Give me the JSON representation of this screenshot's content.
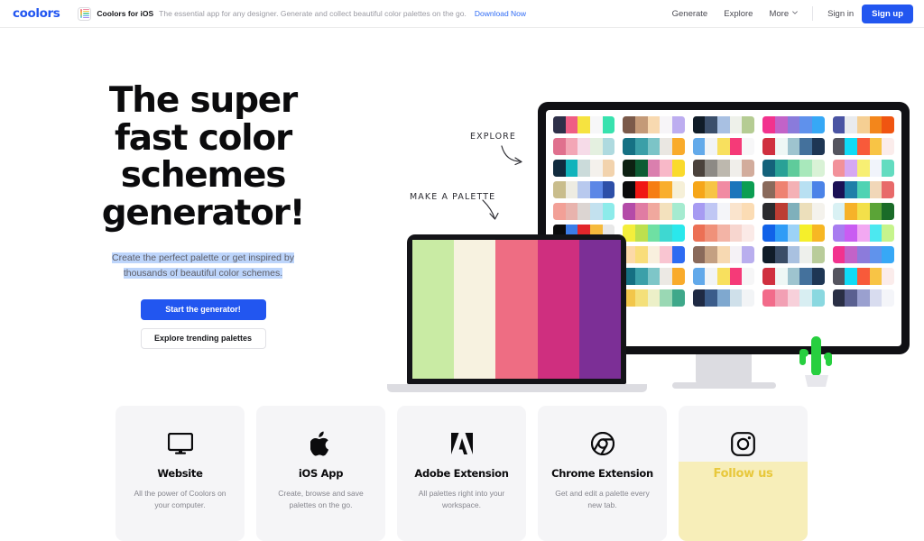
{
  "header": {
    "logo": "coolors",
    "banner": {
      "icon": "ios-app-icon",
      "title": "Coolors for iOS",
      "text": "The essential app for any designer. Generate and collect beautiful color palettes on the go.",
      "link": "Download Now"
    },
    "nav": [
      {
        "label": "Generate"
      },
      {
        "label": "Explore"
      },
      {
        "label": "More",
        "icon": "chevron-down-icon"
      }
    ],
    "signin": "Sign in",
    "signup": "Sign up",
    "accent": "#2256f0"
  },
  "hero": {
    "headline": "The super fast color schemes generator!",
    "subhead": "Create the perfect palette or get inspired by thousands of beautiful color schemes.",
    "primary_button": "Start the generator!",
    "secondary_button": "Explore trending palettes",
    "annotations": [
      {
        "label": "EXPLORE"
      },
      {
        "label": "MAKE A PALETTE"
      }
    ]
  },
  "laptop": {
    "palette": [
      "#c9eba4",
      "#f7f2e0",
      "#ee6d83",
      "#cf2f7f",
      "#7c2f96"
    ]
  },
  "monitor": {
    "palettes": [
      [
        "#2e3049",
        "#ef5e85",
        "#f6e340",
        "#f7f7f8",
        "#38e2ae"
      ],
      [
        "#7b5a4a",
        "#c49a78",
        "#f8d9b0",
        "#f7f5f8",
        "#bdadf0"
      ],
      [
        "#101c28",
        "#3b4f6b",
        "#a8c0e2",
        "#eef1ea",
        "#b5cc93"
      ],
      [
        "#f2338e",
        "#c263c8",
        "#8a7bdb",
        "#5f91ec",
        "#36a8f6"
      ],
      [
        "#4a54a3",
        "#e9ebee",
        "#f5cf93",
        "#f3861b",
        "#f05511"
      ],
      [
        "#e0708e",
        "#f3a6b6",
        "#f6dbe8",
        "#e4f0e0",
        "#aedadf"
      ],
      [
        "#167184",
        "#3b9fa8",
        "#7cc4c7",
        "#eae7e2",
        "#f9ab2b"
      ],
      [
        "#63aaea",
        "#f2f4f6",
        "#f8e05e",
        "#f53a78",
        "#f7f7f8"
      ],
      [
        "#d0303f",
        "#eef7f5",
        "#9ec4cf",
        "#44719c",
        "#1e3654"
      ],
      [
        "#55555f",
        "#10dbf5",
        "#f85a3a",
        "#f8c445",
        "#fbeceb"
      ],
      [
        "#112b3e",
        "#11b3bb",
        "#cbdbda",
        "#f4f1ec",
        "#f2d3ad"
      ],
      [
        "#0d2112",
        "#0d5c34",
        "#da7fae",
        "#f8b8c8",
        "#fada2c"
      ],
      [
        "#4a423c",
        "#8d8a85",
        "#bdb8ae",
        "#f0eeea",
        "#d2ac9c"
      ],
      [
        "#14627a",
        "#29a196",
        "#5fcb9b",
        "#a8e8bb",
        "#d9f2d6"
      ],
      [
        "#f2919a",
        "#d6a8f2",
        "#f7ef73",
        "#f1f4fb",
        "#63dcc0"
      ],
      [
        "#c9bd8c",
        "#eeece2",
        "#b8c9ee",
        "#5c87e6",
        "#2d4fa8"
      ],
      [
        "#0b0b0c",
        "#f01713",
        "#f67d13",
        "#f9ae2d",
        "#f6f0d8"
      ],
      [
        "#f6a619",
        "#f7c445",
        "#f18ba3",
        "#1c75bb",
        "#0c9e52"
      ],
      [
        "#8a6a5b",
        "#ee8271",
        "#f4b1b5",
        "#b8e0f2",
        "#4b83e8"
      ],
      [
        "#1b1155",
        "#1f7fa8",
        "#4fd3b3",
        "#f1d7b8",
        "#e86a6a"
      ],
      [
        "#f2a097",
        "#e8b3ad",
        "#dcd5d2",
        "#c3e1ef",
        "#8cebea"
      ],
      [
        "#b44ba8",
        "#e07ca3",
        "#f0a89e",
        "#f3e1bd",
        "#a5ebd0"
      ],
      [
        "#a79bf2",
        "#c0c7f4",
        "#f4f5f9",
        "#fae4cd",
        "#fbdcb4"
      ],
      [
        "#2b2b2e",
        "#bc3d33",
        "#7fb0bb",
        "#ecdfbb",
        "#f4f2ec"
      ],
      [
        "#d9f1f4",
        "#f6b229",
        "#f3e04a",
        "#5ba437",
        "#1a6b28"
      ],
      [
        "#0b0b0c",
        "#3b7de8",
        "#e2262b",
        "#f6ba3c",
        "#e8e8e8"
      ],
      [
        "#f4ee3c",
        "#bde04e",
        "#6fe0a3",
        "#3ed8d1",
        "#2ae8ec"
      ],
      [
        "#ec7055",
        "#f0917a",
        "#f3b4a6",
        "#f7d6cf",
        "#fbeae7"
      ],
      [
        "#1162e8",
        "#2f9cf6",
        "#9cd2f7",
        "#f5ef2b",
        "#f7b723"
      ],
      [
        "#a87cf0",
        "#c95cf2",
        "#f2a8f2",
        "#4ce8f0",
        "#c6f48c"
      ],
      [
        "#0a36c8",
        "#5a4fdc",
        "#8a8ae0",
        "#ee9aa0",
        "#f34e9e"
      ],
      [
        "#fcd9a8",
        "#f9dd7a",
        "#f9f0de",
        "#f9c5d1",
        "#2e6bf2"
      ],
      [
        "#8a6a5b",
        "#c4a082",
        "#f7d9b2",
        "#f5f2f6",
        "#b9aeee"
      ],
      [
        "#101c28",
        "#3a4d66",
        "#a9c1e0",
        "#eef0ec",
        "#b9cc9a"
      ],
      [
        "#f2338e",
        "#c263c8",
        "#8c7bdb",
        "#6093ec",
        "#37a8f6"
      ],
      [
        "#4a54a3",
        "#e9ebee",
        "#f5cf93",
        "#f3861b",
        "#f05511"
      ],
      [
        "#156f82",
        "#3ba0a9",
        "#7ec6c8",
        "#ece9e4",
        "#f9ab2b"
      ],
      [
        "#62a9ea",
        "#f2f4f6",
        "#f8e05e",
        "#f53a78",
        "#f6f6f7"
      ],
      [
        "#d0303f",
        "#eef7f5",
        "#9ec4cf",
        "#44719c",
        "#1e3654"
      ],
      [
        "#55555f",
        "#10dbf5",
        "#f85a3a",
        "#f8c445",
        "#fbeceb"
      ],
      [
        "#e8e2cf",
        "#f2f0e8",
        "#cfd8ea",
        "#7fa0e2",
        "#3f5fb8"
      ],
      [
        "#f2c64a",
        "#f4e07a",
        "#ecf0c8",
        "#9ad8b4",
        "#3fa88a"
      ],
      [
        "#1f2a44",
        "#3b5c8a",
        "#7fa8cf",
        "#cfe0ea",
        "#f2f4f6"
      ],
      [
        "#f26b8a",
        "#f2a0b4",
        "#f7d0da",
        "#d8eef2",
        "#8ad8e0"
      ],
      [
        "#2a2f45",
        "#5a6090",
        "#9aa0cf",
        "#d8dcef",
        "#f4f5f9"
      ]
    ]
  },
  "cards": [
    {
      "icon": "monitor-icon",
      "title": "Website",
      "desc": "All the power of Coolors on your computer."
    },
    {
      "icon": "apple-icon",
      "title": "iOS App",
      "desc": "Create, browse and save palettes on the go."
    },
    {
      "icon": "adobe-icon",
      "title": "Adobe Extension",
      "desc": "All palettes right into your workspace."
    },
    {
      "icon": "chrome-icon",
      "title": "Chrome Extension",
      "desc": "Get and edit a palette every new tab."
    },
    {
      "icon": "instagram-icon",
      "title": "Follow us",
      "desc": "",
      "bg": "#f7eeb9",
      "title_color": "#e8c83c"
    }
  ]
}
